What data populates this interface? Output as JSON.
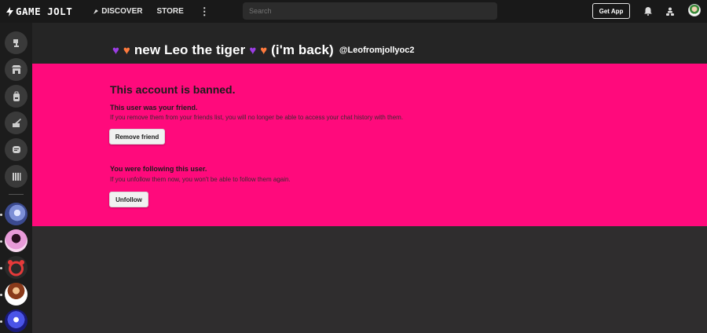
{
  "topbar": {
    "logo_text": "GAME JOLT",
    "discover_label": "DISCOVER",
    "store_label": "STORE",
    "more_label": "⋮",
    "search_placeholder": "Search",
    "get_app_label": "Get App"
  },
  "profile": {
    "title": "new Leo the tiger",
    "suffix": "(i'm back)",
    "handle": "@Leofromjollyoc2"
  },
  "banned": {
    "heading": "This account is banned.",
    "friend_title": "This user was your friend.",
    "friend_text": "If you remove them from your friends list, you will no longer be able to access your chat history with them.",
    "remove_friend_label": "Remove friend",
    "follow_title": "You were following this user.",
    "follow_text": "If you unfollow them now, you won't be able to follow them again.",
    "unfollow_label": "Unfollow"
  },
  "colors": {
    "banned_bg": "#ff0a7c",
    "topbar_bg": "#191919",
    "page_bg": "#2f2d2e"
  },
  "sidebar": {
    "icons": [
      "trophy-icon",
      "store-icon",
      "backpack-icon",
      "quests-icon",
      "chat-icon",
      "library-icon"
    ]
  }
}
